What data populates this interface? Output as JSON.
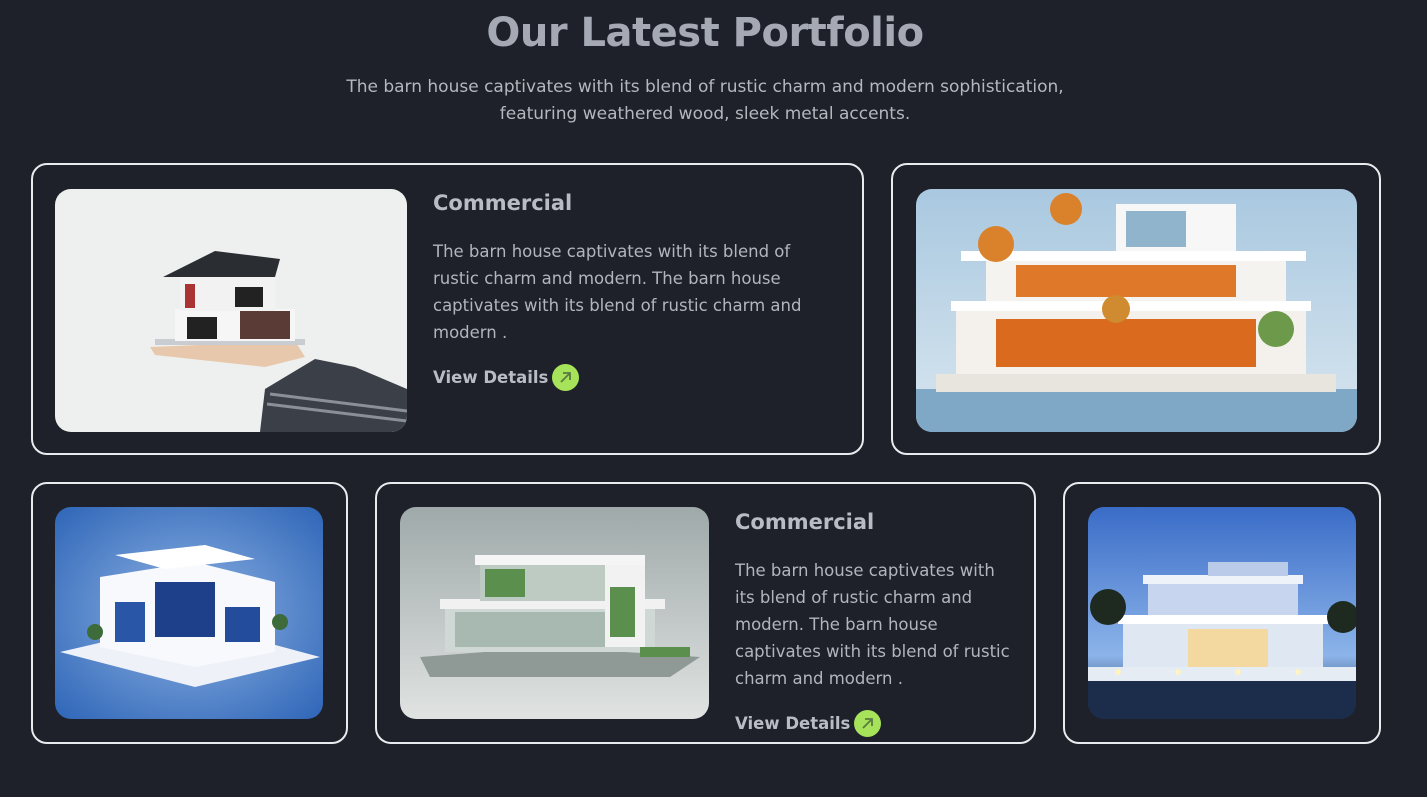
{
  "header": {
    "title": "Our Latest Portfolio",
    "subtitle_line1": "The barn house captivates with its blend of rustic charm and modern sophistication,",
    "subtitle_line2": "featuring weathered wood, sleek metal accents."
  },
  "cards": [
    {
      "title": "Commercial",
      "text": "The barn house captivates with its blend of rustic charm and modern. The barn house captivates with its blend of rustic charm and modern .",
      "link_label": "View Details"
    },
    {
      "title": "Commercial",
      "text": "The barn house captivates with its blend of rustic charm and modern. The barn house captivates with its blend of rustic charm and modern .",
      "link_label": "View Details"
    }
  ],
  "colors": {
    "background": "#1e2129",
    "accent": "#a6e35a",
    "border": "#e9ebef"
  }
}
